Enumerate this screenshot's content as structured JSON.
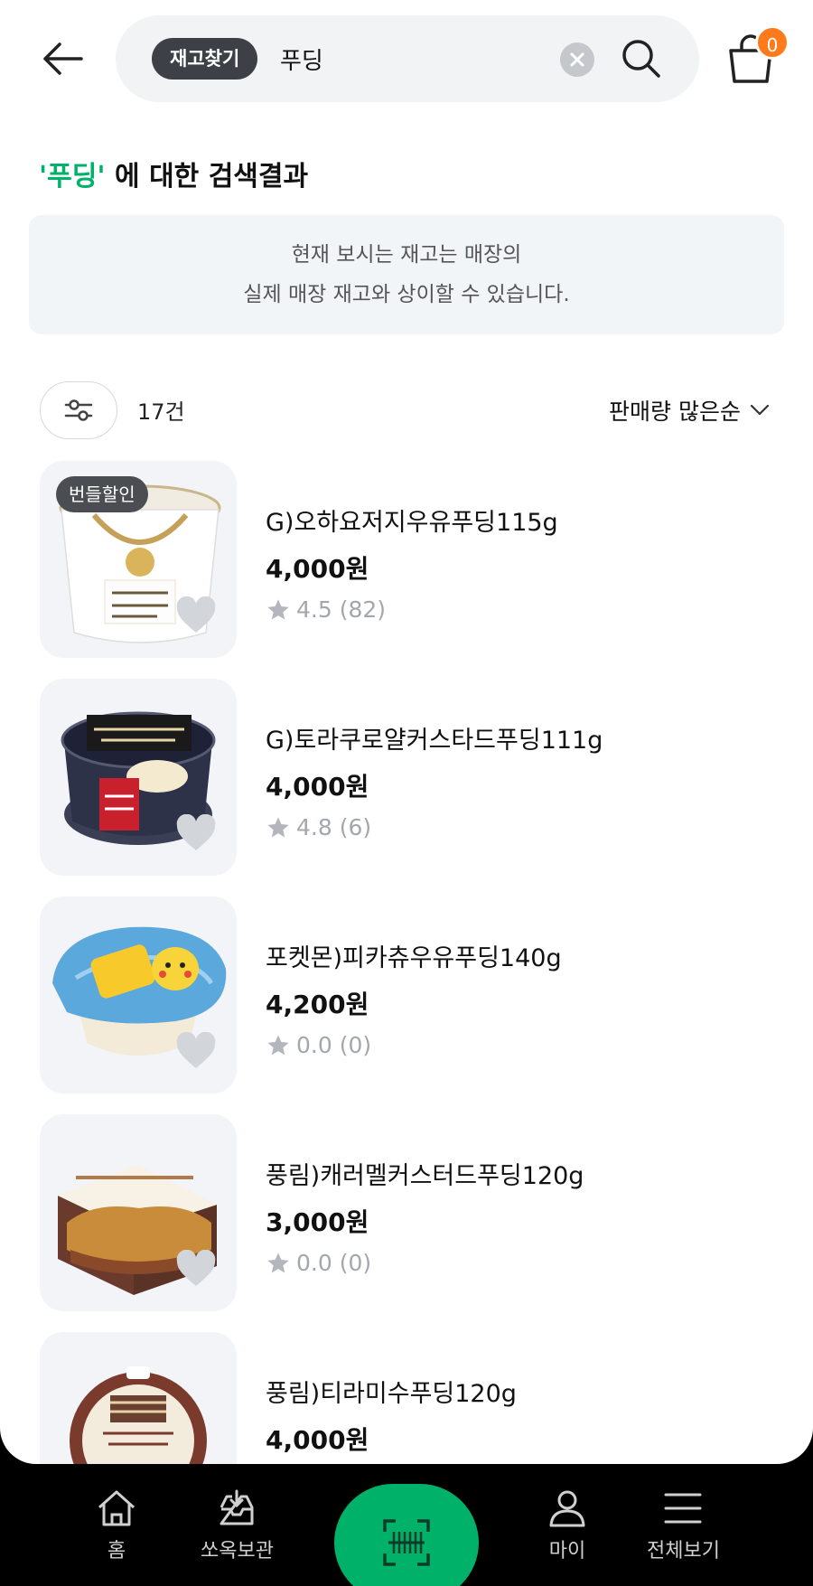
{
  "header": {
    "search_chip": "재고찾기",
    "search_value": "푸딩",
    "cart_count": "0"
  },
  "results": {
    "keyword": "'푸딩'",
    "title_suffix": " 에 대한 검색결과"
  },
  "notice": {
    "line1": "현재 보시는 재고는 매장의",
    "line2": "실제 매장 재고와 상이할 수 있습니다."
  },
  "toolbar": {
    "count": "17건",
    "sort_label": "판매량 많은순"
  },
  "products": [
    {
      "name": "G)오하요저지우유푸딩115g",
      "price": "4,000원",
      "rating": "4.5 (82)",
      "badge": "번들할인"
    },
    {
      "name": "G)토라쿠로얄커스타드푸딩111g",
      "price": "4,000원",
      "rating": "4.8 (6)"
    },
    {
      "name": "포켓몬)피카츄우유푸딩140g",
      "price": "4,200원",
      "rating": "0.0 (0)"
    },
    {
      "name": "풍림)캐러멜커스터드푸딩120g",
      "price": "3,000원",
      "rating": "0.0 (0)"
    },
    {
      "name": "풍림)티라미수푸딩120g",
      "price": "4,000원"
    }
  ],
  "nav": {
    "home": "홈",
    "storage": "쏘옥보관",
    "my": "마이",
    "all": "전체보기"
  },
  "colors": {
    "accent": "#00b16a",
    "badge_orange": "#ff7a1a"
  }
}
